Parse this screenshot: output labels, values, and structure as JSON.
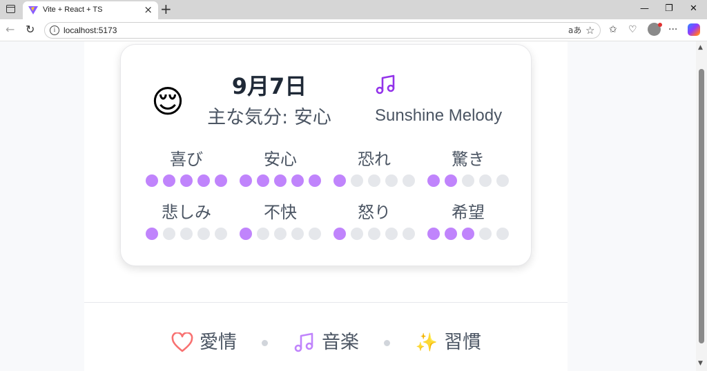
{
  "browser": {
    "tab_title": "Vite + React + TS",
    "url": "localhost:5173",
    "reader_label": "aあ"
  },
  "card": {
    "emoji": "😌",
    "date": "9月7日",
    "mood": "主な気分: 安心",
    "song": "Sunshine Melody",
    "emotions": [
      {
        "label": "喜び",
        "level": 5
      },
      {
        "label": "安心",
        "level": 5
      },
      {
        "label": "恐れ",
        "level": 1
      },
      {
        "label": "驚き",
        "level": 2
      },
      {
        "label": "悲しみ",
        "level": 1
      },
      {
        "label": "不快",
        "level": 1
      },
      {
        "label": "怒り",
        "level": 1
      },
      {
        "label": "希望",
        "level": 3
      }
    ],
    "max_level": 5
  },
  "footer": {
    "love": "愛情",
    "music": "音楽",
    "sparkle_emoji": "✨",
    "habit": "習慣"
  },
  "colors": {
    "accent": "#c084fc",
    "dot_off": "#e5e7eb",
    "music_icon": "#9333ea",
    "heart": "#f87171"
  }
}
